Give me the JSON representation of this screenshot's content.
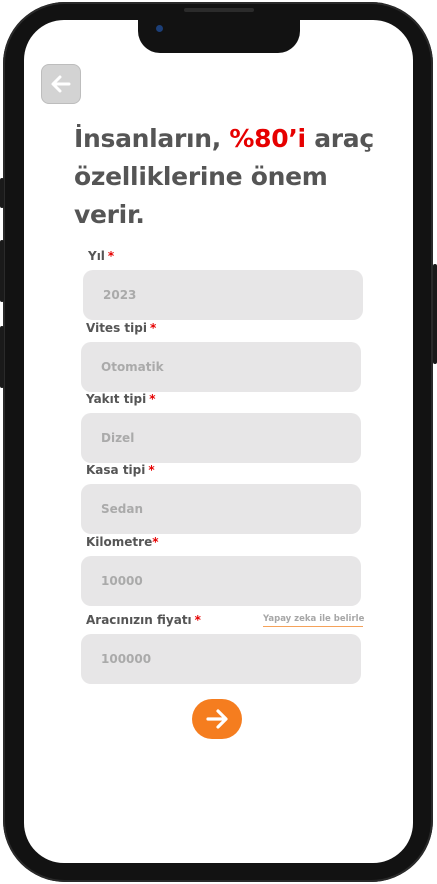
{
  "headline": {
    "part1": "İnsanların, ",
    "highlight": "%80’i",
    "part2": " araç özelliklerine önem verir."
  },
  "fields": [
    {
      "label": "Yıl",
      "required_mark": "*",
      "value": "2023"
    },
    {
      "label": "Vites tipi",
      "required_mark": "*",
      "value": "Otomatik"
    },
    {
      "label": "Yakıt tipi",
      "required_mark": "*",
      "value": "Dizel"
    },
    {
      "label": "Kasa tipi",
      "required_mark": "*",
      "value": "Sedan"
    },
    {
      "label": "Kilometre",
      "required_mark": "*",
      "value": "10000"
    },
    {
      "label": "Aracınızın fiyatı",
      "required_mark": "*",
      "value": "100000"
    }
  ],
  "ai_link": "Yapay zeka ile belirle",
  "icons": {
    "back": "arrow-left-icon",
    "next": "arrow-right-icon"
  },
  "colors": {
    "accent": "#f57d1f",
    "highlight": "#e60000",
    "input_bg": "#e7e6e7",
    "text": "#555555"
  }
}
